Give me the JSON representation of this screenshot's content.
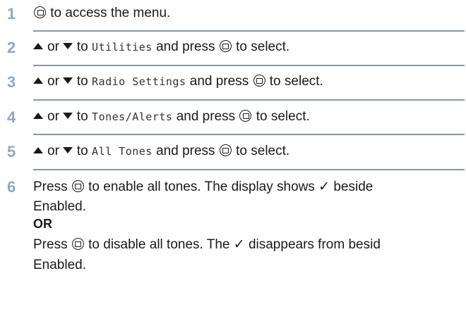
{
  "steps": [
    {
      "num": "1",
      "text": "to access the menu."
    },
    {
      "num": "2",
      "or": "or",
      "to": "to",
      "target": "Utilities",
      "and_press": "and press",
      "to_select": "to select."
    },
    {
      "num": "3",
      "or": "or",
      "to": "to",
      "target": "Radio Settings",
      "and_press": "and press",
      "to_select": "to select."
    },
    {
      "num": "4",
      "or": "or",
      "to": "to",
      "target": "Tones/Alerts",
      "and_press": "and press",
      "to_select": "to select."
    },
    {
      "num": "5",
      "or": "or",
      "to": "to",
      "target": "All Tones",
      "and_press": "and press",
      "to_select": "to select."
    },
    {
      "num": "6",
      "line1_press": "Press",
      "line1_rest": "to enable all tones. The display shows ✓ beside",
      "line2": "Enabled.",
      "or_label": "OR",
      "line3_press": "Press",
      "line3_rest": "to disable all tones. The ✓ disappears from besid",
      "line4": "Enabled."
    }
  ],
  "colors": {
    "step_number": "#8da9c4",
    "rule": "#7f98ae",
    "text": "#1a1a1a"
  },
  "icons": {
    "menu_ok": "menu-ok-button-icon",
    "up": "up-arrow-icon",
    "down": "down-arrow-icon"
  }
}
